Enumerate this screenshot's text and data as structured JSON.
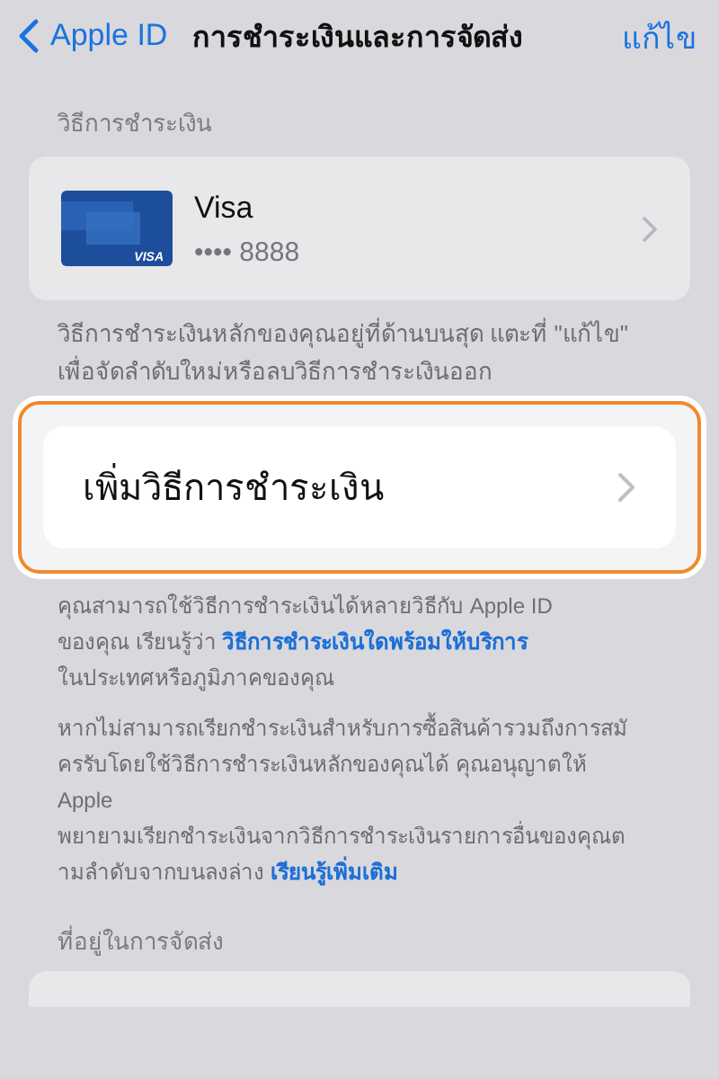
{
  "nav": {
    "back": "Apple ID",
    "title": "การชำระเงินและการจัดส่ง",
    "action": "แก้ไข"
  },
  "payment_section": {
    "header": "วิธีการชำระเงิน",
    "methods": [
      {
        "name": "Visa",
        "number": "•••• 8888",
        "card_brand": "VISA"
      }
    ],
    "footer": "วิธีการชำระเงินหลักของคุณอยู่ที่ด้านบนสุด แตะที่ \"แก้ไข\"\nเพื่อจัดลำดับใหม่หรือลบวิธีการชำระเงินออก",
    "add_button": {
      "label": "เพิ่มวิธีการชำระเงิน",
      "highlighted": true
    },
    "notes": [
      {
        "before": "คุณสามารถใช้วิธีการชำระเงินได้หลายวิธีกับ Apple ID\nของคุณ เรียนรู้ว่า ",
        "link": "วิธีการชำระเงินใดพร้อมให้บริการ",
        "after": "\nในประเทศหรือภูมิภาคของคุณ"
      },
      {
        "before": "หากไม่สามารถเรียกชำระเงินสำหรับการซื้อสินค้ารวมถึงการสมั\nครรับโดยใช้วิธีการชำระเงินหลักของคุณได้ คุณอนุญาตให้\nApple\nพยายามเรียกชำระเงินจากวิธีการชำระเงินรายการอื่นของคุณต\nามลำดับจากบนลงล่าง ",
        "link": "เรียนรู้เพิ่มเติม"
      }
    ]
  },
  "shipping_section": {
    "header": "ที่อยู่ในการจัดส่ง"
  }
}
